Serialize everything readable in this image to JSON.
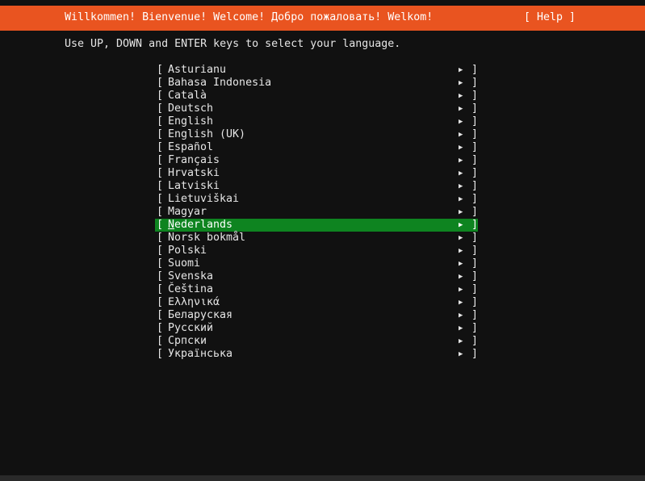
{
  "header": {
    "title": "Willkommen! Bienvenue! Welcome! Добро пожаловать! Welkom!",
    "help_label": "[ Help ]",
    "color": "#e95420"
  },
  "instructions": "Use UP, DOWN and ENTER keys to select your language.",
  "list": {
    "bracket_left": "[",
    "bracket_right": "]",
    "arrow": "▶",
    "selected_color": "#0e8420",
    "selected_index": 12,
    "items": [
      "Asturianu",
      "Bahasa Indonesia",
      "Català",
      "Deutsch",
      "English",
      "English (UK)",
      "Español",
      "Français",
      "Hrvatski",
      "Latviski",
      "Lietuviškai",
      "Magyar",
      "Nederlands",
      "Norsk bokmål",
      "Polski",
      "Suomi",
      "Svenska",
      "Čeština",
      "Ελληνικά",
      "Беларуская",
      "Русский",
      "Српски",
      "Українська"
    ]
  }
}
